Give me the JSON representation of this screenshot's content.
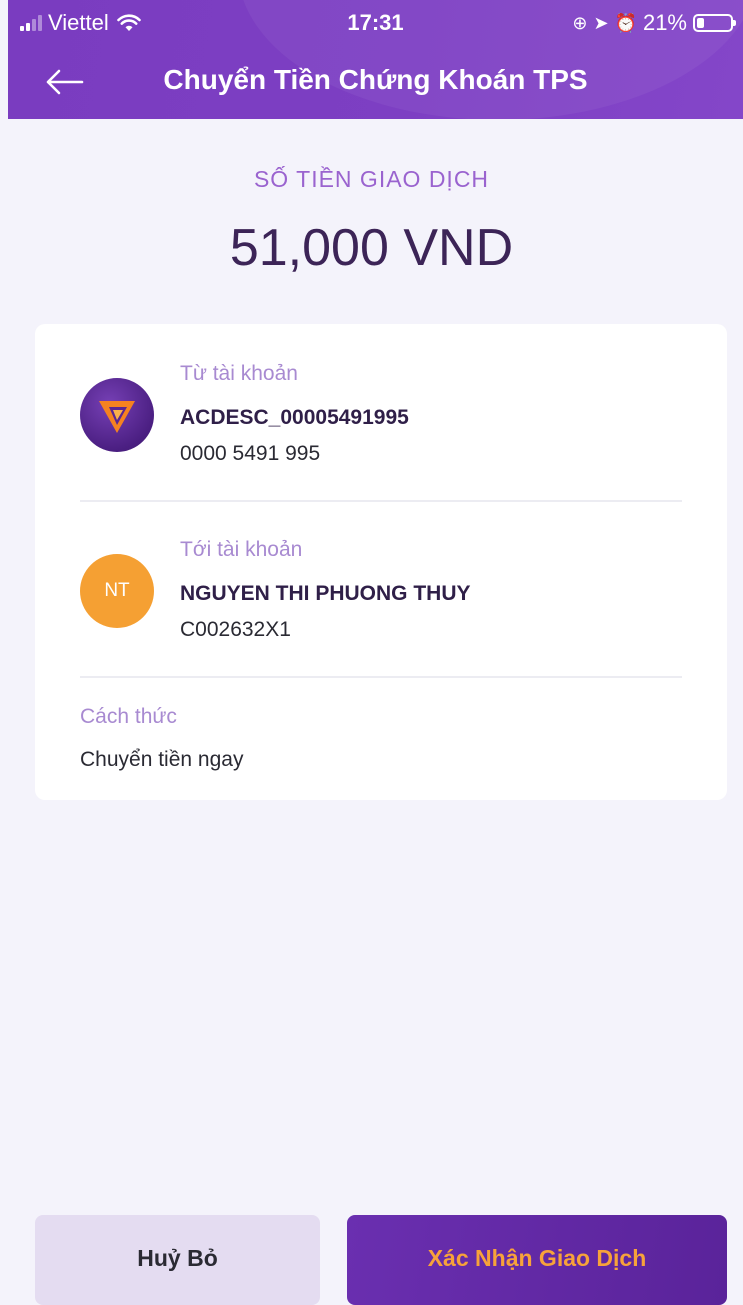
{
  "status_bar": {
    "carrier": "Viettel",
    "time": "17:31",
    "battery": "21%",
    "battery_level": 0.21
  },
  "nav": {
    "title": "Chuyển Tiền Chứng Khoán TPS"
  },
  "amount": {
    "label": "SỐ TIỀN GIAO DỊCH",
    "value": "51,000 VND"
  },
  "from_account": {
    "label": "Từ tài khoản",
    "name": "ACDESC_00005491995",
    "number": "0000 5491 995"
  },
  "to_account": {
    "label": "Tới tài khoản",
    "initials": "NT",
    "name": "NGUYEN THI PHUONG THUY",
    "number": "C002632X1"
  },
  "method": {
    "label": "Cách thức",
    "value": "Chuyển tiền ngay"
  },
  "actions": {
    "cancel_label": "Huỷ Bỏ",
    "confirm_label": "Xác Nhận Giao Dịch"
  },
  "colors": {
    "header": "#7a3cc0",
    "accent": "#9a63cf",
    "confirm_text": "#f7a23a",
    "avatar_to": "#f5a033"
  }
}
